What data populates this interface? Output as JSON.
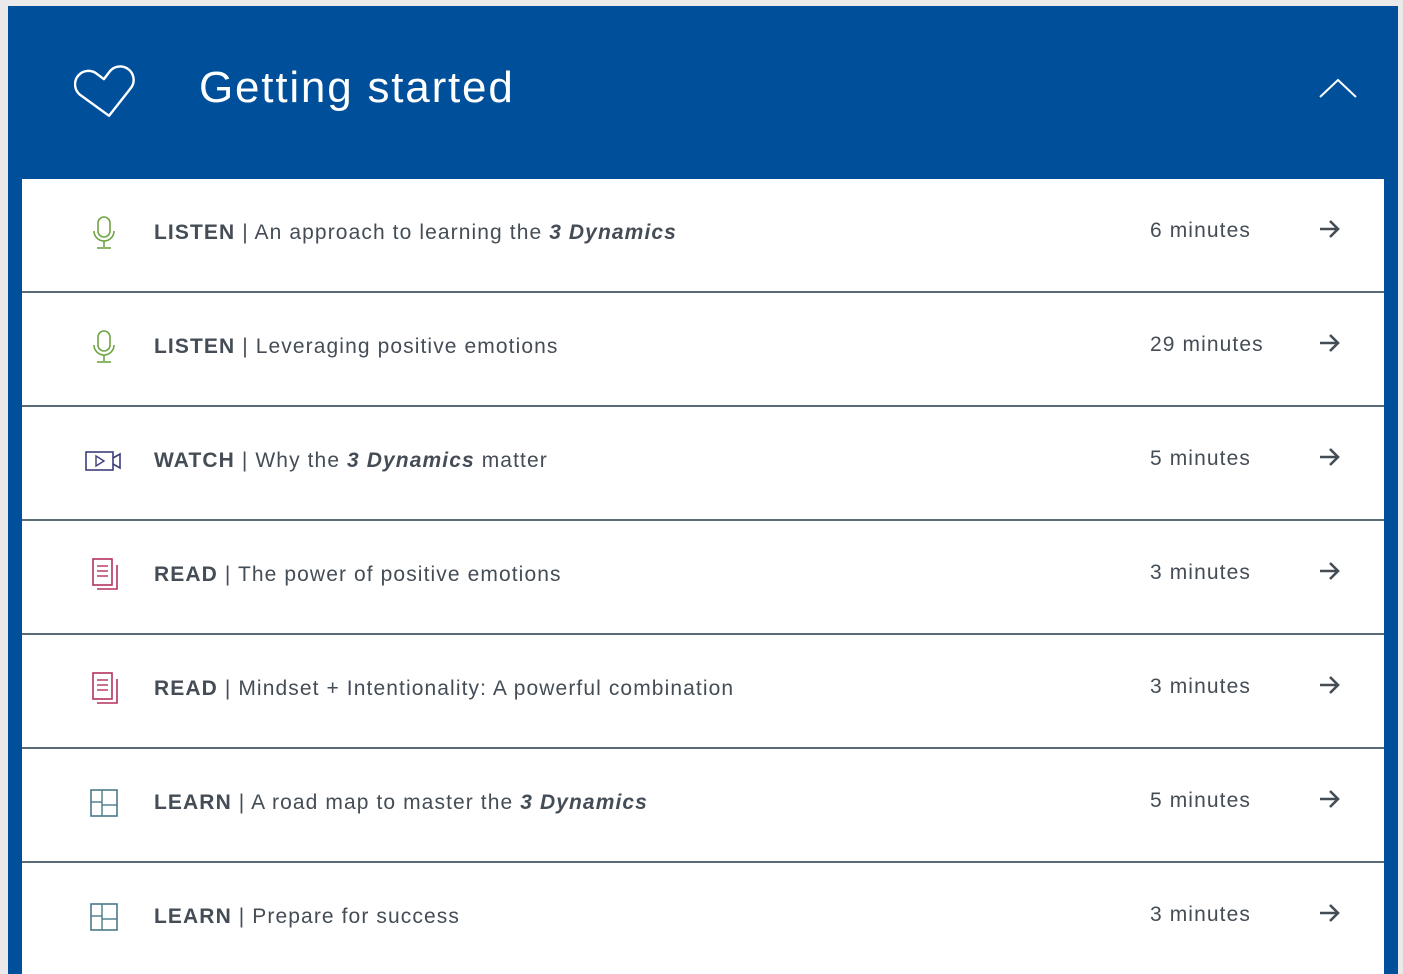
{
  "section": {
    "title": "Getting started",
    "icon": "heart-icon",
    "toggle_icon": "chevron-up-icon",
    "colors": {
      "header_bg": "#004f9a",
      "listen": "#6fa544",
      "watch": "#3c3f7a",
      "read": "#b3325f",
      "learn": "#4a7a8a",
      "text": "#444d56"
    }
  },
  "items": [
    {
      "kind": "LISTEN",
      "sep": " | ",
      "text": "An approach to learning the ",
      "em": "3 Dynamics",
      "tail": "",
      "duration": "6 minutes",
      "icon": "microphone-icon"
    },
    {
      "kind": "LISTEN",
      "sep": " | ",
      "text": "Leveraging positive emotions",
      "em": "",
      "tail": "",
      "duration": "29 minutes",
      "icon": "microphone-icon"
    },
    {
      "kind": "WATCH",
      "sep": " | ",
      "text": "Why the ",
      "em": "3 Dynamics",
      "tail": " matter",
      "duration": "5 minutes",
      "icon": "video-camera-icon"
    },
    {
      "kind": "READ",
      "sep": " | ",
      "text": "The power of positive emotions",
      "em": "",
      "tail": "",
      "duration": "3 minutes",
      "icon": "document-icon"
    },
    {
      "kind": "READ",
      "sep": " | ",
      "text": "Mindset + Intentionality: A powerful combination",
      "em": "",
      "tail": "",
      "duration": "3 minutes",
      "icon": "document-icon"
    },
    {
      "kind": "LEARN",
      "sep": " | ",
      "text": "A road map to master the ",
      "em": "3 Dynamics",
      "tail": "",
      "duration": "5 minutes",
      "icon": "layout-grid-icon"
    },
    {
      "kind": "LEARN",
      "sep": " | ",
      "text": "Prepare for success",
      "em": "",
      "tail": "",
      "duration": "3 minutes",
      "icon": "layout-grid-icon"
    }
  ]
}
